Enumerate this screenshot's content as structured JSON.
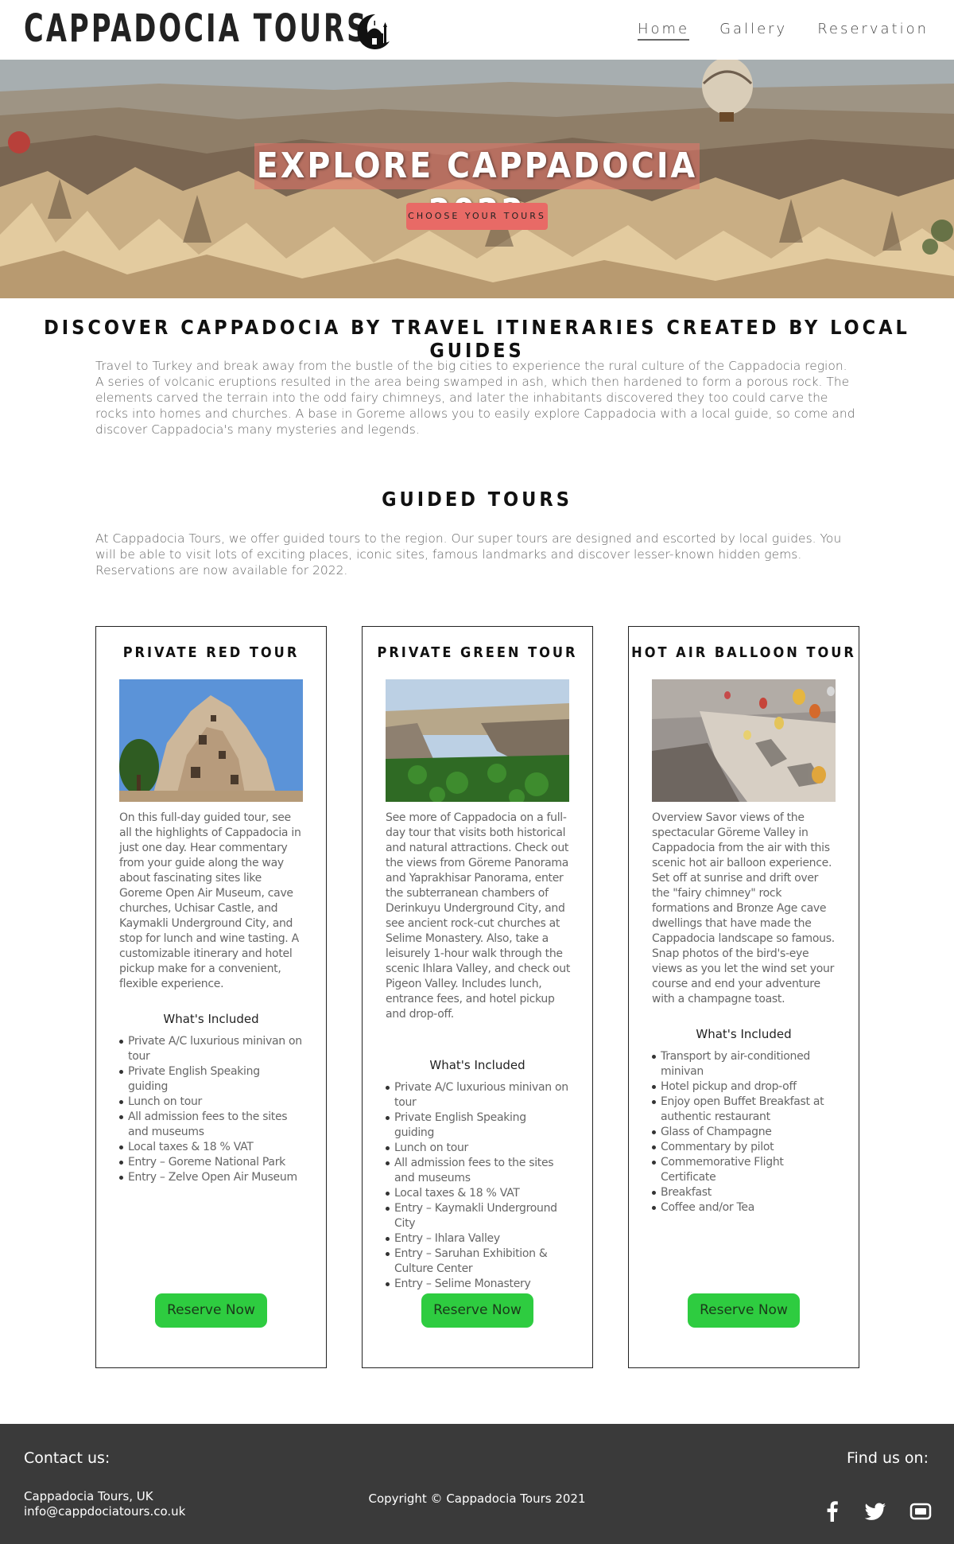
{
  "header": {
    "brand": "CAPPADOCIA TOURS",
    "logo_icon": "mosque-crescent-icon",
    "nav": [
      {
        "label": "Home",
        "active": true
      },
      {
        "label": "Gallery",
        "active": false
      },
      {
        "label": "Reservation",
        "active": false
      }
    ]
  },
  "hero": {
    "title": "EXPLORE CAPPADOCIA 2022",
    "cta": "CHOOSE YOUR TOURS"
  },
  "intro": {
    "heading": "DISCOVER CAPPADOCIA BY TRAVEL ITINERARIES CREATED BY LOCAL GUIDES",
    "text": "Travel to Turkey and break away from the bustle of the big cities to experience the rural culture of the Cappadocia region. A series of volcanic eruptions resulted in the area being swamped in ash, which then hardened to form a porous rock. The elements carved the terrain into the odd fairy chimneys, and later the inhabitants discovered they too could carve the rocks into homes and churches. A base in Goreme allows you to easily explore Cappadocia with a local guide, so come and discover Cappadocia's many mysteries and legends."
  },
  "tours": {
    "heading": "GUIDED TOURS",
    "text": "At Cappadocia Tours, we offer guided tours to the region. Our super tours are designed and escorted by local guides. You will be able to visit lots of exciting places, iconic sites, famous landmarks and discover lesser-known hidden gems. Reservations are now available for 2022.",
    "cards": [
      {
        "title": "PRIVATE RED TOUR",
        "description": "On this full-day guided tour, see all the highlights of Cappadocia in just one day. Hear commentary from your guide along the way about fascinating sites like Goreme Open Air Museum, cave churches, Uchisar Castle, and Kaymakli Underground City, and stop for lunch and wine tasting. A customizable itinerary and hotel pickup make for a convenient, flexible experience.",
        "included_label": "What's Included",
        "included": [
          "Private A/C luxurious minivan on tour",
          "Private English Speaking guiding",
          "Lunch on tour",
          "All admission fees to the sites and museums",
          "Local taxes & 18 % VAT",
          "Entry – Goreme National Park",
          "Entry – Zelve Open Air Museum"
        ],
        "button": "Reserve Now"
      },
      {
        "title": "PRIVATE GREEN TOUR",
        "description": "See more of Cappadocia on a full-day tour that visits both historical and natural attractions. Check out the views from Göreme Panorama and Yaprakhisar Panorama, enter the subterranean chambers of Derinkuyu Underground City, and see ancient rock-cut churches at Selime Monastery. Also, take a leisurely 1-hour walk through the scenic Ihlara Valley, and check out Pigeon Valley. Includes lunch, entrance fees, and hotel pickup and drop-off.",
        "included_label": "What's Included",
        "included": [
          "Private A/C luxurious minivan on tour",
          "Private English Speaking guiding",
          "Lunch on tour",
          "All admission fees to the sites and museums",
          "Local taxes & 18 % VAT",
          "Entry – Kaymakli Underground City",
          "Entry – Ihlara Valley",
          "Entry – Saruhan Exhibition & Culture Center",
          "Entry – Selime Monastery"
        ],
        "button": "Reserve Now"
      },
      {
        "title": "HOT AIR BALLOON TOUR",
        "description": "Overview Savor views of the spectacular Göreme Valley in Cappadocia from the air with this scenic hot air balloon experience. Set off at sunrise and drift over the \"fairy chimney\" rock formations and Bronze Age cave dwellings that have made the Cappadocia landscape so famous. Snap photos of the bird's-eye views as you let the wind set your course and end your adventure with a champagne toast.",
        "included_label": "What's Included",
        "included": [
          "Transport by air-conditioned minivan",
          "Hotel pickup and drop-off",
          "Enjoy open Buffet Breakfast at authentic restaurant",
          "Glass of Champagne",
          "Commentary by pilot",
          "Commemorative Flight Certificate",
          "Breakfast",
          "Coffee and/or Tea"
        ],
        "button": "Reserve Now"
      }
    ]
  },
  "footer": {
    "contact_heading": "Contact us:",
    "company": "Cappadocia Tours, UK",
    "email": "info@cappdociatours.co.uk",
    "copyright": "Copyright © Cappadocia Tours 2021",
    "find_heading": "Find us on:",
    "social": [
      "facebook-icon",
      "twitter-icon",
      "youtube-icon"
    ]
  },
  "colors": {
    "hero_button": "#e86a66",
    "reserve_button": "#2ecc40",
    "footer_bg": "#3a3a3a"
  }
}
